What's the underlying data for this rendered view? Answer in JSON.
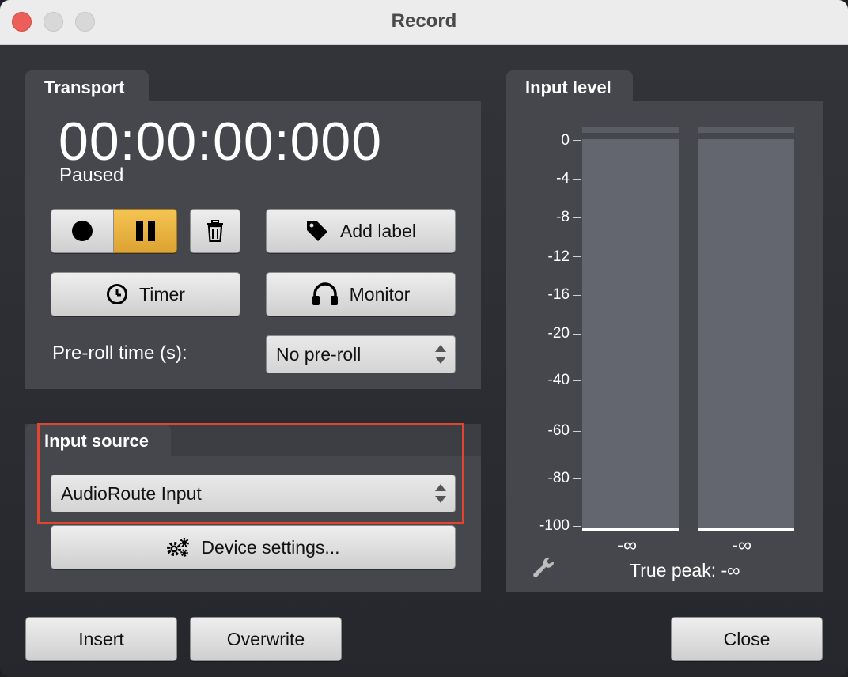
{
  "window": {
    "title": "Record"
  },
  "transport": {
    "tab_label": "Transport",
    "timecode": "00:00:00:000",
    "status": "Paused",
    "add_label": "Add label",
    "timer_label": "Timer",
    "monitor_label": "Monitor",
    "preroll_label": "Pre-roll time (s):",
    "preroll_value": "No pre-roll"
  },
  "input_source": {
    "tab_label": "Input source",
    "device": "AudioRoute Input",
    "settings_label": "Device settings..."
  },
  "input_level": {
    "tab_label": "Input level",
    "scale": [
      "0",
      "-4",
      "-8",
      "-12",
      "-16",
      "-20",
      "-40",
      "-60",
      "-80",
      "-100"
    ],
    "left_value": "-∞",
    "right_value": "-∞",
    "true_peak": "True peak: -∞"
  },
  "footer": {
    "insert_label": "Insert",
    "overwrite_label": "Overwrite",
    "close_label": "Close"
  },
  "colors": {
    "accent_active": "#f5c453",
    "highlight": "#e0452f",
    "panel": "#45474d"
  }
}
